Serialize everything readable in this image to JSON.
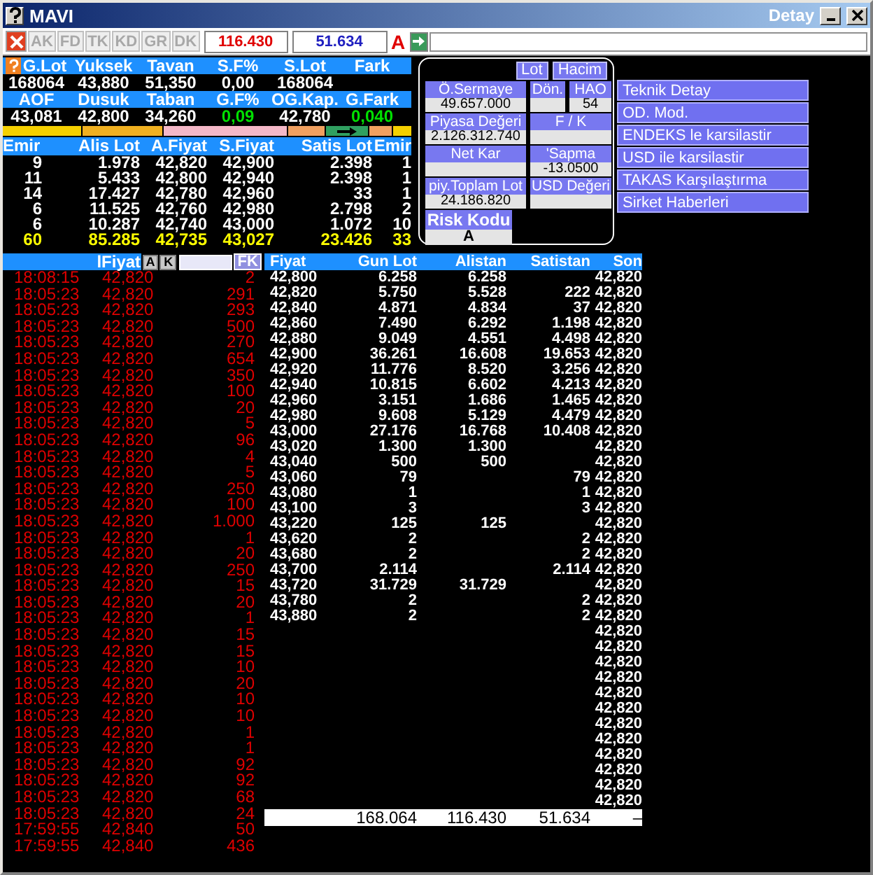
{
  "window": {
    "title": "MAVI",
    "detail_label": "Detay"
  },
  "toolbar": {
    "buttons": [
      {
        "label": "AK",
        "disabled": true
      },
      {
        "label": "FD",
        "disabled": true
      },
      {
        "label": "TK",
        "disabled": true
      },
      {
        "label": "KD",
        "disabled": true
      },
      {
        "label": "GR",
        "disabled": true
      },
      {
        "label": "DK",
        "disabled": true
      }
    ],
    "buy_total": "116.430",
    "sell_total": "51.634",
    "mode": "A"
  },
  "stats": [
    {
      "columns": [
        "G.Lot",
        "Yuksek",
        "Tavan",
        "S.F%",
        "S.Lot",
        "Fark"
      ],
      "values": [
        {
          "text": "168064",
          "positive": false
        },
        {
          "text": "43,880",
          "positive": false
        },
        {
          "text": "51,350",
          "positive": false
        },
        {
          "text": "0,00",
          "positive": false
        },
        {
          "text": "168064",
          "positive": false
        }
      ]
    },
    {
      "columns": [
        "AOF",
        "Dusuk",
        "Taban",
        "G.F%",
        "OG.Kap.",
        "G.Fark"
      ],
      "values": [
        {
          "text": "43,081",
          "positive": false
        },
        {
          "text": "42,800",
          "positive": false
        },
        {
          "text": "34,260",
          "positive": false
        },
        {
          "text": "0,09",
          "positive": true
        },
        {
          "text": "42,780",
          "positive": false
        },
        {
          "text": "0,040",
          "positive": true
        }
      ]
    }
  ],
  "order_book": {
    "columns": [
      "Emir",
      "Alis Lot",
      "A.Fiyat",
      "S.Fiyat",
      "Satis Lot",
      "Emir"
    ],
    "rows": [
      {
        "kind": "order",
        "cells": [
          "9",
          "1.978",
          "42,820",
          "42,900",
          "2.398",
          "1"
        ]
      },
      {
        "kind": "order",
        "cells": [
          "11",
          "5.433",
          "42,800",
          "42,940",
          "2.398",
          "1"
        ]
      },
      {
        "kind": "order",
        "cells": [
          "14",
          "17.427",
          "42,780",
          "42,960",
          "33",
          "1"
        ]
      },
      {
        "kind": "order",
        "cells": [
          "6",
          "11.525",
          "42,760",
          "42,980",
          "2.798",
          "2"
        ]
      },
      {
        "kind": "order",
        "cells": [
          "6",
          "10.287",
          "42,740",
          "43,000",
          "1.072",
          "10"
        ]
      },
      {
        "kind": "total",
        "cells": [
          "60",
          "85.285",
          "42,735",
          "43,027",
          "23.426",
          "33"
        ]
      }
    ]
  },
  "info_panel": {
    "toggles": [
      "Lot",
      "Hacim"
    ],
    "rows": [
      [
        {
          "label": "Ö.Sermaye",
          "value": "49.657.000"
        },
        {
          "label": "Dön."
        },
        {
          "label": "HAO",
          "value": "54"
        }
      ],
      [
        {
          "label": "Piyasa Değeri",
          "value": "2.126.312.740"
        },
        {
          "label": "F / K"
        }
      ],
      [
        {
          "label": "Net Kar"
        },
        {
          "label": "'Sapma",
          "value": "-13.0500"
        }
      ],
      [
        {
          "label": "piy.Toplam Lot",
          "value": "24.186.820"
        },
        {
          "label": "USD Değeri"
        }
      ]
    ],
    "risk": {
      "label": "Risk Kodu",
      "value": "A"
    }
  },
  "actions": [
    "Teknik Detay",
    "OD. Mod.",
    "ENDEKS le karsilastir",
    "USD ile karsilastir",
    "TAKAS Karşılaştırma",
    "Sirket Haberleri"
  ],
  "trades": {
    "header_label": "lFiyat",
    "buttons": [
      "A",
      "K"
    ],
    "filter_button": "FK",
    "rows": [
      {
        "time": "18:08:15",
        "price": "42,820",
        "lot": "2"
      },
      {
        "time": "18:05:23",
        "price": "42,820",
        "lot": "291"
      },
      {
        "time": "18:05:23",
        "price": "42,820",
        "lot": "293"
      },
      {
        "time": "18:05:23",
        "price": "42,820",
        "lot": "500"
      },
      {
        "time": "18:05:23",
        "price": "42,820",
        "lot": "270"
      },
      {
        "time": "18:05:23",
        "price": "42,820",
        "lot": "654"
      },
      {
        "time": "18:05:23",
        "price": "42,820",
        "lot": "350"
      },
      {
        "time": "18:05:23",
        "price": "42,820",
        "lot": "100"
      },
      {
        "time": "18:05:23",
        "price": "42,820",
        "lot": "20"
      },
      {
        "time": "18:05:23",
        "price": "42,820",
        "lot": "5"
      },
      {
        "time": "18:05:23",
        "price": "42,820",
        "lot": "96"
      },
      {
        "time": "18:05:23",
        "price": "42,820",
        "lot": "4"
      },
      {
        "time": "18:05:23",
        "price": "42,820",
        "lot": "5"
      },
      {
        "time": "18:05:23",
        "price": "42,820",
        "lot": "250"
      },
      {
        "time": "18:05:23",
        "price": "42,820",
        "lot": "100"
      },
      {
        "time": "18:05:23",
        "price": "42,820",
        "lot": "1.000"
      },
      {
        "time": "18:05:23",
        "price": "42,820",
        "lot": "1"
      },
      {
        "time": "18:05:23",
        "price": "42,820",
        "lot": "20"
      },
      {
        "time": "18:05:23",
        "price": "42,820",
        "lot": "250"
      },
      {
        "time": "18:05:23",
        "price": "42,820",
        "lot": "15"
      },
      {
        "time": "18:05:23",
        "price": "42,820",
        "lot": "20"
      },
      {
        "time": "18:05:23",
        "price": "42,820",
        "lot": "1"
      },
      {
        "time": "18:05:23",
        "price": "42,820",
        "lot": "15"
      },
      {
        "time": "18:05:23",
        "price": "42,820",
        "lot": "15"
      },
      {
        "time": "18:05:23",
        "price": "42,820",
        "lot": "10"
      },
      {
        "time": "18:05:23",
        "price": "42,820",
        "lot": "20"
      },
      {
        "time": "18:05:23",
        "price": "42,820",
        "lot": "10"
      },
      {
        "time": "18:05:23",
        "price": "42,820",
        "lot": "10"
      },
      {
        "time": "18:05:23",
        "price": "42,820",
        "lot": "1"
      },
      {
        "time": "18:05:23",
        "price": "42,820",
        "lot": "1"
      },
      {
        "time": "18:05:23",
        "price": "42,820",
        "lot": "92"
      },
      {
        "time": "18:05:23",
        "price": "42,820",
        "lot": "92"
      },
      {
        "time": "18:05:23",
        "price": "42,820",
        "lot": "68"
      },
      {
        "time": "18:05:23",
        "price": "42,820",
        "lot": "24"
      },
      {
        "time": "17:59:55",
        "price": "42,840",
        "lot": "50"
      },
      {
        "time": "17:59:55",
        "price": "42,840",
        "lot": "436"
      }
    ]
  },
  "depth": {
    "columns": [
      "Fiyat",
      "Gun Lot",
      "Alistan",
      "Satistan",
      "Son"
    ],
    "rows": [
      {
        "price": "42,800",
        "gun_lot": "6.258",
        "alistan": "6.258",
        "son": "42,820"
      },
      {
        "price": "42,820",
        "gun_lot": "5.750",
        "alistan": "5.528",
        "satistan": "222",
        "son": "42,820"
      },
      {
        "price": "42,840",
        "gun_lot": "4.871",
        "alistan": "4.834",
        "satistan": "37",
        "son": "42,820"
      },
      {
        "price": "42,860",
        "gun_lot": "7.490",
        "alistan": "6.292",
        "satistan": "1.198",
        "son": "42,820"
      },
      {
        "price": "42,880",
        "gun_lot": "9.049",
        "alistan": "4.551",
        "satistan": "4.498",
        "son": "42,820"
      },
      {
        "price": "42,900",
        "gun_lot": "36.261",
        "alistan": "16.608",
        "satistan": "19.653",
        "son": "42,820"
      },
      {
        "price": "42,920",
        "gun_lot": "11.776",
        "alistan": "8.520",
        "satistan": "3.256",
        "son": "42,820"
      },
      {
        "price": "42,940",
        "gun_lot": "10.815",
        "alistan": "6.602",
        "satistan": "4.213",
        "son": "42,820"
      },
      {
        "price": "42,960",
        "gun_lot": "3.151",
        "alistan": "1.686",
        "satistan": "1.465",
        "son": "42,820"
      },
      {
        "price": "42,980",
        "gun_lot": "9.608",
        "alistan": "5.129",
        "satistan": "4.479",
        "son": "42,820"
      },
      {
        "price": "43,000",
        "gun_lot": "27.176",
        "alistan": "16.768",
        "satistan": "10.408",
        "son": "42,820"
      },
      {
        "price": "43,020",
        "gun_lot": "1.300",
        "alistan": "1.300",
        "son": "42,820"
      },
      {
        "price": "43,040",
        "gun_lot": "500",
        "alistan": "500",
        "son": "42,820"
      },
      {
        "price": "43,060",
        "gun_lot": "79",
        "satistan": "79",
        "son": "42,820"
      },
      {
        "price": "43,080",
        "gun_lot": "1",
        "satistan": "1",
        "son": "42,820"
      },
      {
        "price": "43,100",
        "gun_lot": "3",
        "satistan": "3",
        "son": "42,820"
      },
      {
        "price": "43,220",
        "gun_lot": "125",
        "alistan": "125",
        "son": "42,820"
      },
      {
        "price": "43,620",
        "gun_lot": "2",
        "satistan": "2",
        "son": "42,820"
      },
      {
        "price": "43,680",
        "gun_lot": "2",
        "satistan": "2",
        "son": "42,820"
      },
      {
        "price": "43,700",
        "gun_lot": "2.114",
        "satistan": "2.114",
        "son": "42,820"
      },
      {
        "price": "43,720",
        "gun_lot": "31.729",
        "alistan": "31.729",
        "son": "42,820"
      },
      {
        "price": "43,780",
        "gun_lot": "2",
        "satistan": "2",
        "son": "42,820"
      },
      {
        "price": "43,880",
        "gun_lot": "2",
        "satistan": "2",
        "son": "42,820"
      },
      {
        "son": "42,820"
      },
      {
        "son": "42,820"
      },
      {
        "son": "42,820"
      },
      {
        "son": "42,820"
      },
      {
        "son": "42,820"
      },
      {
        "son": "42,820"
      },
      {
        "son": "42,820"
      },
      {
        "son": "42,820"
      },
      {
        "son": "42,820"
      },
      {
        "son": "42,820"
      },
      {
        "son": "42,820"
      },
      {
        "son": "42,820"
      }
    ],
    "totals": [
      "168.064",
      "116.430",
      "51.634",
      "–"
    ]
  }
}
